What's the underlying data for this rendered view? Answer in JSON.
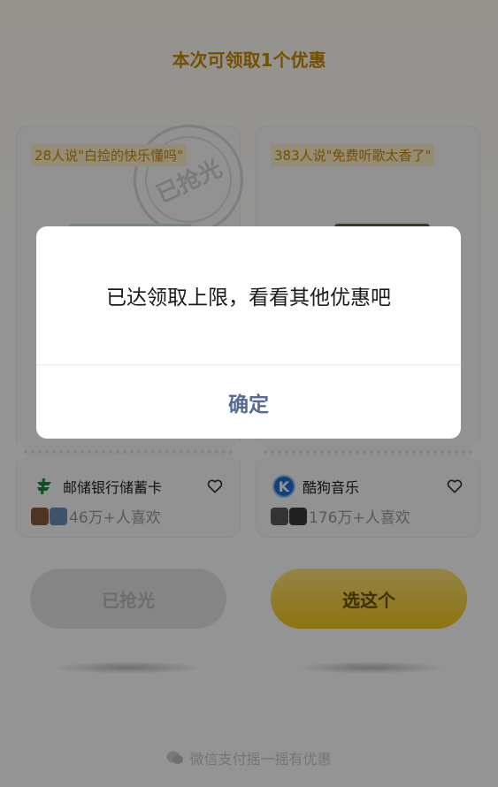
{
  "header": {
    "title": "本次可领取1个优惠"
  },
  "offers": [
    {
      "quote": "28人说\"白捡的快乐懂吗\"",
      "stamp": "已抢光",
      "brand": "邮储银行储蓄卡",
      "brand_icon": "psbc-logo-icon",
      "likes": "46万+人喜欢",
      "button": "已抢光"
    },
    {
      "quote": "383人说\"免费听歌太香了\"",
      "brand": "酷狗音乐",
      "brand_icon": "kugou-logo-icon",
      "brand_icon_glyph": "K",
      "likes": "176万+人喜欢",
      "button": "选这个"
    }
  ],
  "footer": {
    "text": "微信支付摇一摇有优惠"
  },
  "dialog": {
    "message": "已达领取上限，看看其他优惠吧",
    "confirm": "确定"
  },
  "colors": {
    "accent": "#c98a00",
    "button_yellow": "#f3c71e",
    "dialog_link": "#576b95",
    "overlay": "rgba(0,0,0,0.42)"
  }
}
